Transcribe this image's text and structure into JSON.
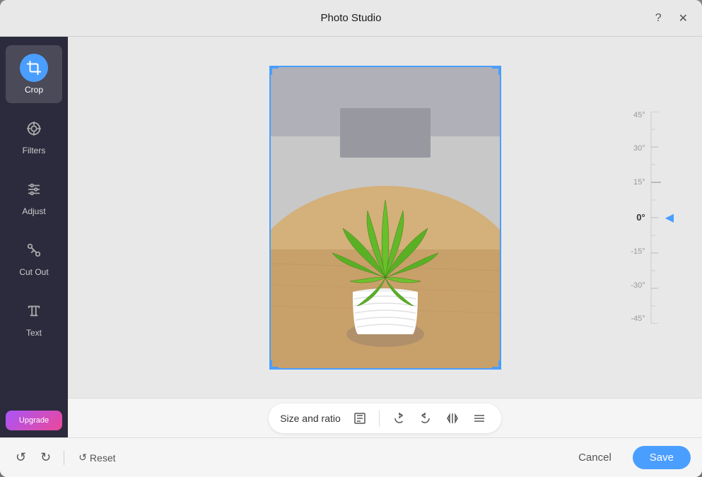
{
  "window": {
    "title": "Photo Studio"
  },
  "titlebar": {
    "title": "Photo Studio",
    "help_btn": "?",
    "close_btn": "✕"
  },
  "sidebar": {
    "items": [
      {
        "id": "crop",
        "label": "Crop",
        "active": true
      },
      {
        "id": "filters",
        "label": "Filters",
        "active": false
      },
      {
        "id": "adjust",
        "label": "Adjust",
        "active": false
      },
      {
        "id": "cutout",
        "label": "Cut Out",
        "active": false
      },
      {
        "id": "text",
        "label": "Text",
        "active": false
      }
    ],
    "upgrade_label": "Upgrade"
  },
  "ruler": {
    "labels": [
      "45°",
      "30°",
      "15°",
      "0°",
      "-15°",
      "-30°",
      "-45°"
    ]
  },
  "toolbar": {
    "size_and_ratio_label": "Size and ratio"
  },
  "actions": {
    "reset_label": "Reset",
    "cancel_label": "Cancel",
    "save_label": "Save"
  }
}
